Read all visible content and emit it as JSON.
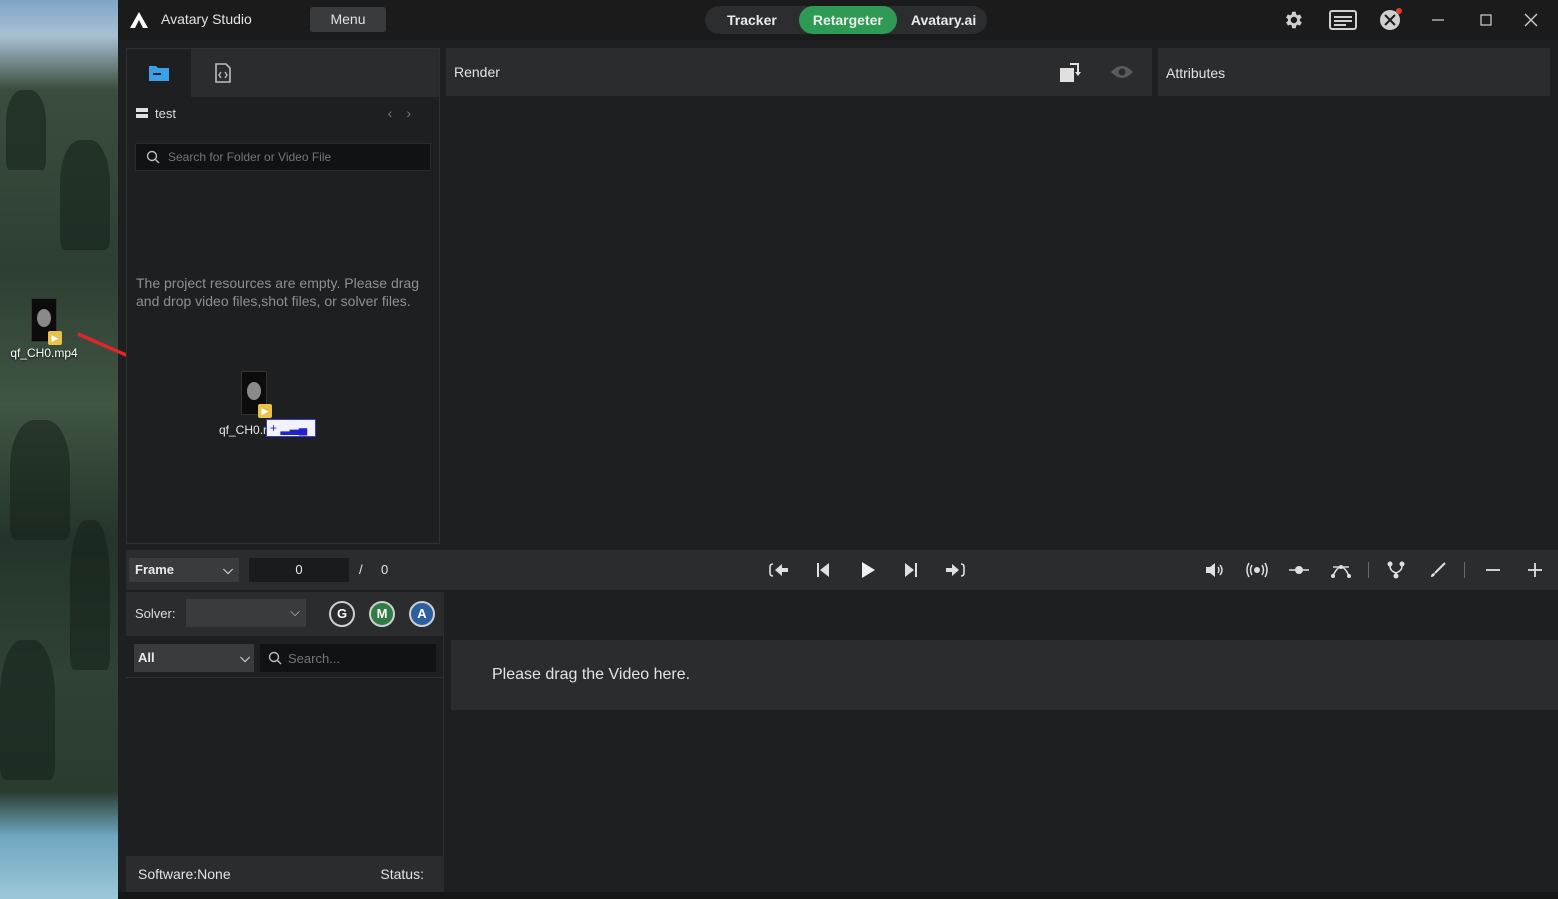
{
  "desktop": {
    "file_name": "qf_CH0.mp4"
  },
  "titlebar": {
    "app_title": "Avatary Studio",
    "menu_label": "Menu",
    "modes": [
      "Tracker",
      "Retargeter",
      "Avatary.ai"
    ],
    "active_mode": "Retargeter",
    "icons": [
      "gear-icon",
      "message-icon",
      "account-icon"
    ],
    "window_buttons": [
      "minimize",
      "maximize",
      "close"
    ]
  },
  "left_panel": {
    "tabs": [
      "folder-icon",
      "script-file-icon"
    ],
    "folder_name": "test",
    "search_placeholder": "Search for Folder or Video File",
    "empty_message": "The project resources are empty. Please drag and drop video files,shot files, or solver files.",
    "drag_ghost_label": "qf_CH0.r"
  },
  "render_panel": {
    "title": "Render"
  },
  "attributes_panel": {
    "title": "Attributes"
  },
  "timeline": {
    "frame_mode": "Frame",
    "current_frame": "0",
    "separator": "/",
    "total_frames": "0"
  },
  "solver": {
    "label": "Solver:",
    "selected": "",
    "buttons": [
      "G",
      "M",
      "A"
    ],
    "filter_selected": "All",
    "search_placeholder": "Search..."
  },
  "status": {
    "software": "Software:None",
    "status": "Status:"
  },
  "drop_area": {
    "message": "Please drag the Video here."
  },
  "colors": {
    "accent_green": "#2f9a55",
    "panel_bg": "#1e1f20",
    "header_bg": "#2b2c2e",
    "folder_blue": "#3aa0e8",
    "arrow_red": "#e0262b"
  }
}
